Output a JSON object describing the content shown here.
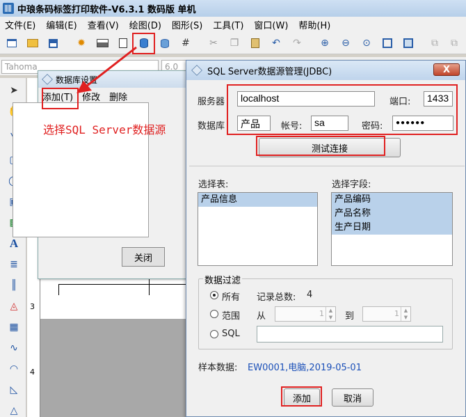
{
  "app": {
    "title": "中琅条码标签打印软件-V6.3.1 数码版 单机"
  },
  "menu": [
    "文件(E)",
    "编辑(E)",
    "查看(V)",
    "绘图(D)",
    "图形(S)",
    "工具(T)",
    "窗口(W)",
    "帮助(H)"
  ],
  "fontbar": {
    "font": "Tahoma",
    "size": "6.0"
  },
  "ruler": {
    "v1": "3",
    "v2": "4"
  },
  "db_window": {
    "title": "数据库设置",
    "menu": [
      "添加(T)",
      "修改",
      "删除"
    ],
    "close_label": "关闭"
  },
  "annotation": "选择SQL Server数据源",
  "sql_dialog": {
    "title": "SQL Server数据源管理(JDBC)",
    "close_glyph": "X",
    "server_label": "服务器",
    "server_value": "localhost",
    "port_label": "端口:",
    "port_value": "1433",
    "database_label": "数据库",
    "database_value": "产品",
    "account_label": "帐号:",
    "account_value": "sa",
    "password_label": "密码:",
    "password_value": "●●●●●●",
    "test_button": "测试连接",
    "select_table_label": "选择表:",
    "tables": [
      "产品信息"
    ],
    "select_field_label": "选择字段:",
    "fields": [
      "产品编码",
      "产品名称",
      "生产日期"
    ],
    "filter_title": "数据过滤",
    "opt_all": "所有",
    "record_count_label": "记录总数:",
    "record_count": "4",
    "opt_range": "范围",
    "from_label": "从",
    "from_value": "1",
    "to_label": "到",
    "to_value": "1",
    "opt_sql": "SQL",
    "sample_label": "样本数据:",
    "sample_value": "EW0001,电脑,2019-05-01",
    "add_button": "添加",
    "cancel_button": "取消"
  },
  "colors": {
    "highlight": "#e02020",
    "accent": "#1a4fb8"
  }
}
